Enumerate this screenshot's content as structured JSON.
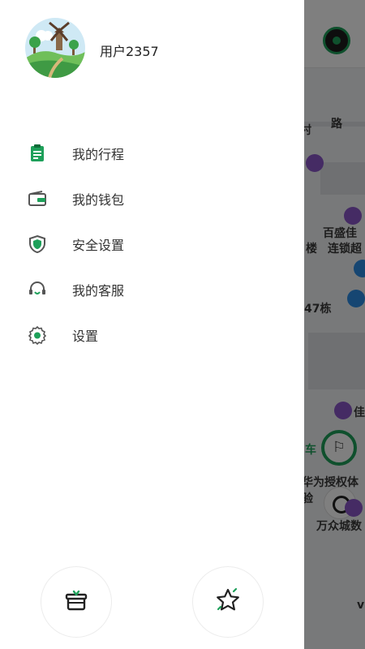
{
  "profile": {
    "username": "用户2357",
    "avatar_icon": "windmill-avatar-icon"
  },
  "menu": [
    {
      "label": "我的行程",
      "icon": "trip-clipboard-icon"
    },
    {
      "label": "我的钱包",
      "icon": "wallet-icon"
    },
    {
      "label": "安全设置",
      "icon": "shield-icon"
    },
    {
      "label": "我的客服",
      "icon": "headset-icon"
    },
    {
      "label": "设置",
      "icon": "gear-icon"
    }
  ],
  "bottom_buttons": [
    {
      "icon": "gift-icon"
    },
    {
      "icon": "star-icon"
    }
  ],
  "map": {
    "labels": [
      "路",
      "村",
      "百盛佳",
      "连锁超",
      "楼",
      "47栋",
      "佳",
      "车",
      "华为授权体验",
      "万众城数",
      "vi"
    ]
  },
  "colors": {
    "accent": "#1ea05a",
    "text": "#333333",
    "overlay": "rgba(0,0,0,0.5)"
  }
}
